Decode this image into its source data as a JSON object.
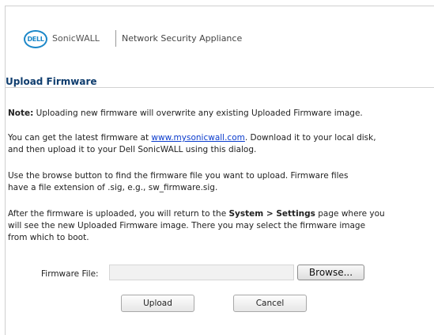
{
  "header": {
    "logo_text": "DELL",
    "brand": "SonicWALL",
    "product": "Network Security Appliance"
  },
  "title": "Upload Firmware",
  "note": {
    "label": "Note:",
    "text": " Uploading new firmware will overwrite any existing Uploaded Firmware image."
  },
  "para2": {
    "pre": "You can get the latest firmware at ",
    "link": "www.mysonicwall.com",
    "post": ". Download it to your local disk,",
    "line2": "and then upload it to your Dell SonicWALL using this dialog."
  },
  "para3": {
    "line1": "Use the browse button to find the firmware file you want to upload. Firmware files",
    "line2": "have a file extension of .sig, e.g., sw_firmware.sig."
  },
  "para4": {
    "pre": "After the firmware is uploaded, you will return to the ",
    "bold": "System > Settings",
    "post": " page where you",
    "line2": "will see the new Uploaded Firmware image. There you may select the firmware image",
    "line3": "from which to boot."
  },
  "form": {
    "file_label": "Firmware File:",
    "file_value": "",
    "browse_label": "Browse...",
    "upload_label": "Upload",
    "cancel_label": "Cancel"
  },
  "colors": {
    "logo_blue": "#1b87c8",
    "title_blue": "#0f3d6e",
    "link_blue": "#0a3bcc"
  }
}
